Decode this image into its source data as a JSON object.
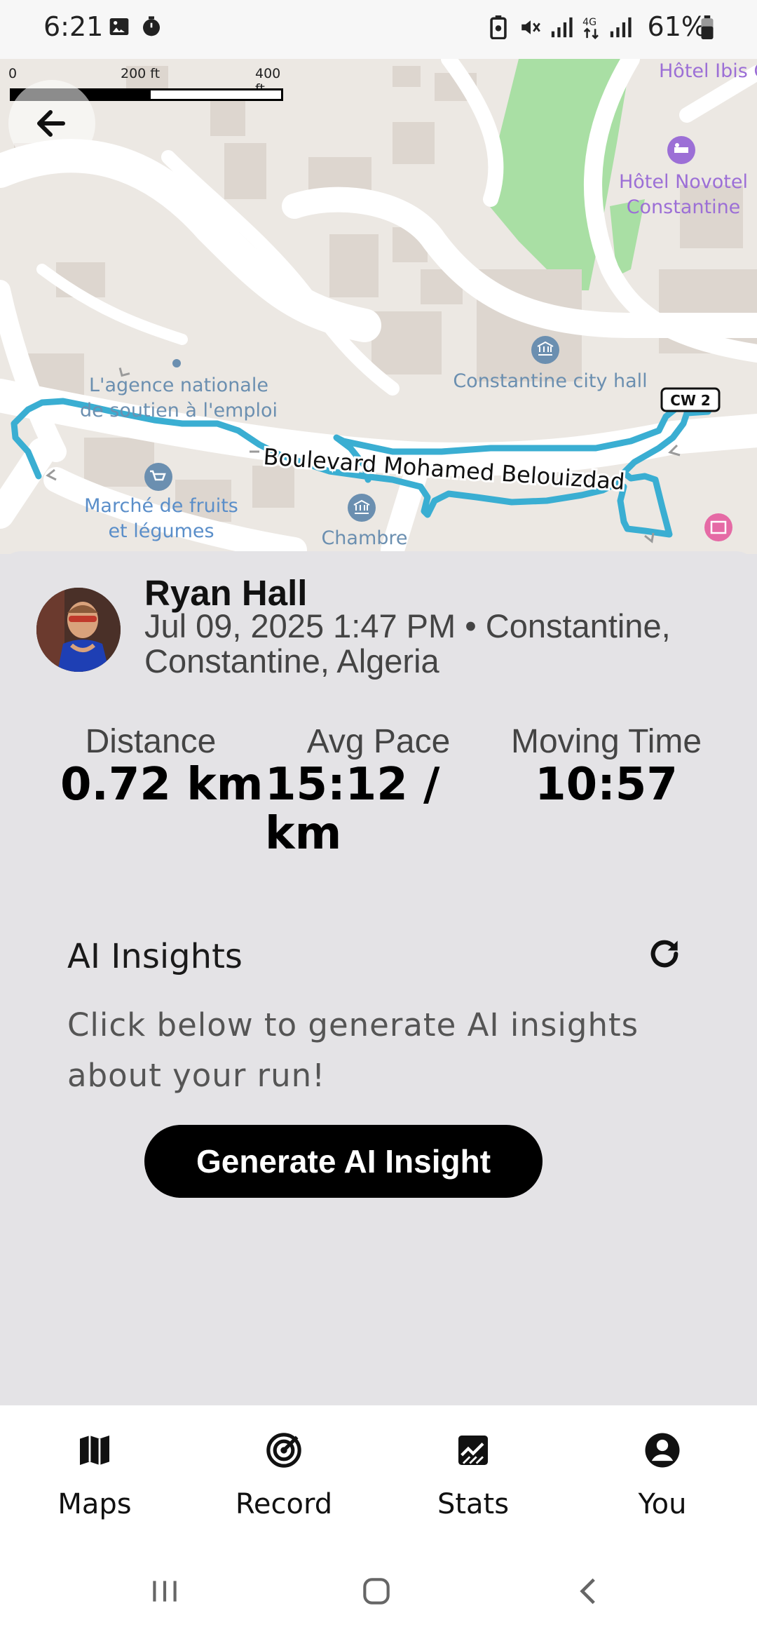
{
  "status_bar": {
    "time": "6:21",
    "battery": "61%",
    "icons": [
      "gallery-icon",
      "timer-icon",
      "battery-saver-icon",
      "mute-icon",
      "signal-icon",
      "4g-icon",
      "signal-icon",
      "battery-icon"
    ]
  },
  "map": {
    "scale": {
      "zero": "0",
      "mid": "200 ft",
      "end": "400 ft"
    },
    "labels": {
      "hotel_ibis": "Hôtel Ibis C",
      "hotel_novotel": "Hôtel Novotel\nConstantine",
      "city_hall": "Constantine city hall",
      "agence": "L'agence nationale\nde soutien à l'emploi",
      "boulevard": "Boulevard Mohamed Belouizdad",
      "marche": "Marché de fruits\net légumes",
      "chambre": "Chambre",
      "road_badge": "CW 2"
    },
    "colors": {
      "route": "#3aaed2",
      "poi_blue": "#6b8fb0",
      "poi_purple": "#9c6fd6",
      "park": "#a8dfa3"
    }
  },
  "activity": {
    "athlete_name": "Ryan Hall",
    "meta": "Jul 09, 2025 1:47 PM • Constantine, Constantine, Algeria",
    "stats": {
      "distance_label": "Distance",
      "distance_value": "0.72 km",
      "pace_label": "Avg Pace",
      "pace_value": "15:12 / km",
      "time_label": "Moving Time",
      "time_value": "10:57"
    }
  },
  "insights": {
    "title": "AI Insights",
    "body": "Click below to generate AI insights about your run!",
    "button": "Generate AI Insight"
  },
  "nav": {
    "items": [
      {
        "label": "Maps",
        "icon": "map-icon"
      },
      {
        "label": "Record",
        "icon": "record-icon"
      },
      {
        "label": "Stats",
        "icon": "stats-icon"
      },
      {
        "label": "You",
        "icon": "profile-icon"
      }
    ]
  }
}
